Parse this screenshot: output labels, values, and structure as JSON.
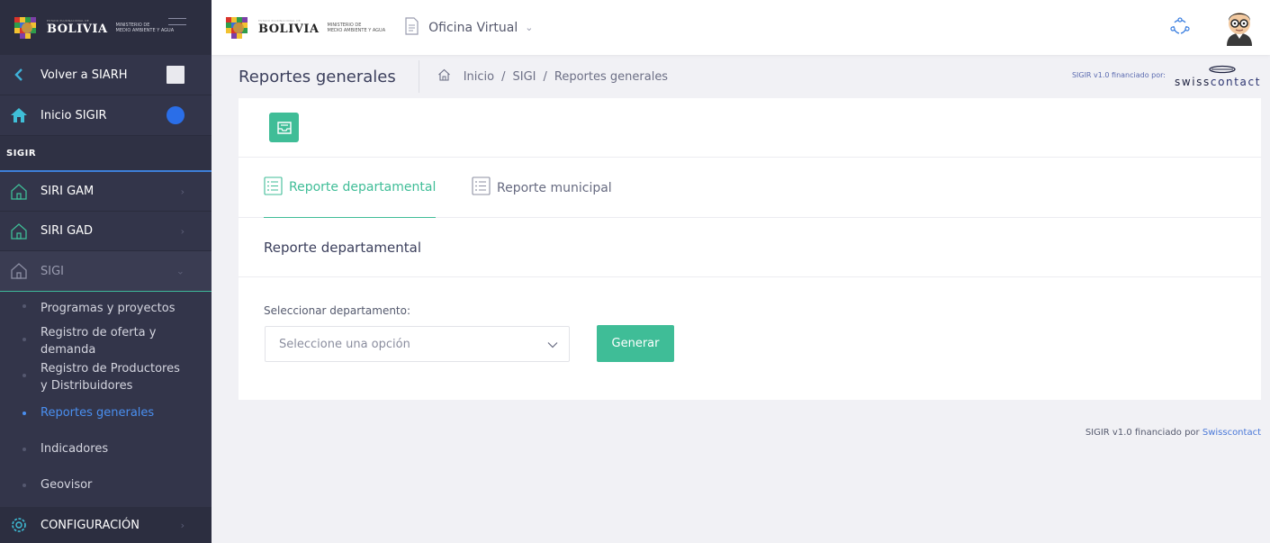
{
  "brand": {
    "country_small": "ESTADO PLURINACIONAL DE",
    "country": "BOLIVIA",
    "ministry_line1": "MINISTERIO DE",
    "ministry_line2": "MEDIO AMBIENTE Y AGUA"
  },
  "topbar": {
    "app_label": "Oficina Virtual"
  },
  "sidebar": {
    "back_label": "Volver a SIARH",
    "home_label": "Inicio SIGIR",
    "section_label": "SIGIR",
    "menus": [
      {
        "label": "SIRI GAM"
      },
      {
        "label": "SIRI GAD"
      },
      {
        "label": "SIGI"
      }
    ],
    "sub_items": [
      {
        "label": "Programas y proyectos"
      },
      {
        "label": "Registro de oferta y demanda"
      },
      {
        "label": "Registro de Productores y Distribuidores"
      },
      {
        "label": "Reportes generales"
      },
      {
        "label": "Indicadores"
      },
      {
        "label": "Geovisor"
      }
    ],
    "config_label": "CONFIGURACIÓN"
  },
  "page": {
    "title": "Reportes generales",
    "breadcrumb": [
      "Inicio",
      "SIGI",
      "Reportes generales"
    ],
    "funded_text": "SIGIR v1.0 financiado por:",
    "sponsor_a": "swiss",
    "sponsor_b": "contact"
  },
  "tabs": [
    {
      "label": "Reporte departamental",
      "active": true
    },
    {
      "label": "Reporte municipal",
      "active": false
    }
  ],
  "report": {
    "section_title": "Reporte departamental",
    "field_label": "Seleccionar departamento:",
    "select_placeholder": "Seleccione una opción",
    "generate_label": "Generar"
  },
  "footer": {
    "text": "SIGIR v1.0 financiado por ",
    "link": "Swisscontact"
  },
  "colors": {
    "accent": "#3fbd97",
    "sidebar": "#33354a",
    "link": "#4a8ff0"
  }
}
